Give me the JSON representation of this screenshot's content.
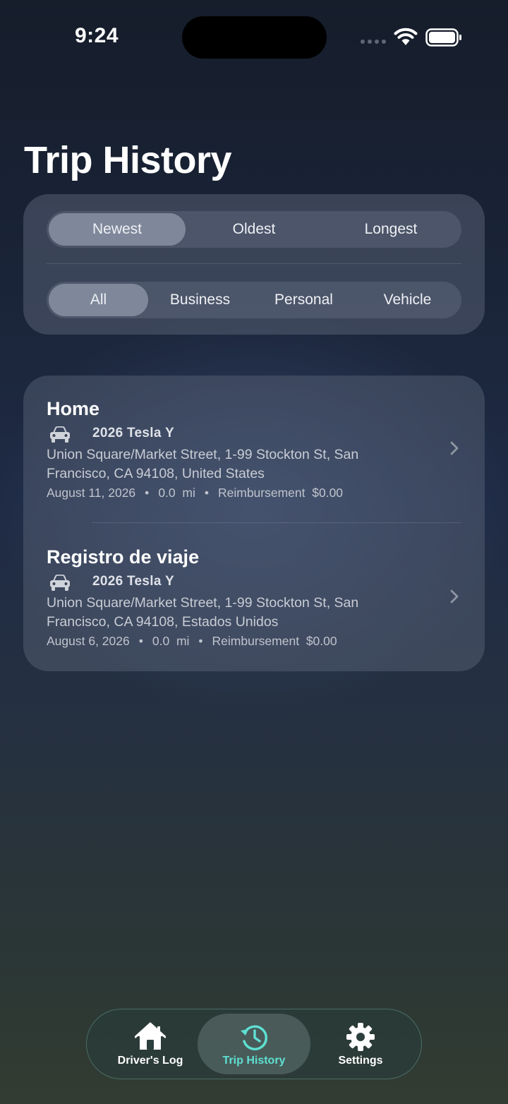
{
  "status_bar": {
    "time": "9:24"
  },
  "page": {
    "title": "Trip History"
  },
  "filters": {
    "sort": [
      "Newest",
      "Oldest",
      "Longest"
    ],
    "sort_selected": "Newest",
    "type": [
      "All",
      "Business",
      "Personal",
      "Vehicle"
    ],
    "type_selected": "All"
  },
  "trips": [
    {
      "name": "Home",
      "vehicle": "2026 Tesla Y",
      "address": "Union Square/Market Street, 1-99 Stockton St, San Francisco, CA  94108, United States",
      "date": "August 11, 2026",
      "distance": "0.0",
      "unit": "mi",
      "reimbursement_label": "Reimbursement",
      "reimbursement": "$0.00"
    },
    {
      "name": "Registro de viaje",
      "vehicle": "2026 Tesla Y",
      "address": "Union Square/Market Street, 1-99 Stockton St, San Francisco, CA  94108, Estados Unidos",
      "date": "August 6, 2026",
      "distance": "0.0",
      "unit": "mi",
      "reimbursement_label": "Reimbursement",
      "reimbursement": "$0.00"
    }
  ],
  "tab_bar": {
    "items": [
      {
        "label": "Driver's Log",
        "icon": "house-icon"
      },
      {
        "label": "Trip History",
        "icon": "history-icon"
      },
      {
        "label": "Settings",
        "icon": "gear-icon"
      }
    ],
    "active": "Trip History",
    "accent_color": "#5ee0d2"
  }
}
